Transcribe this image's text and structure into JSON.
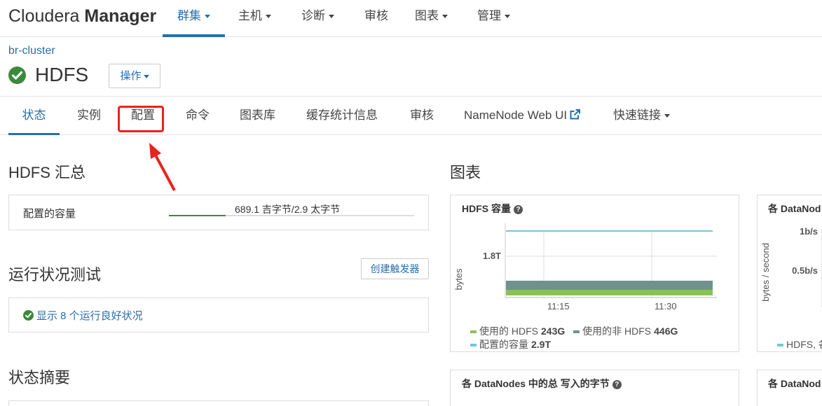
{
  "brand": {
    "part1": "Cloudera",
    "part2": "Manager"
  },
  "topnav": [
    {
      "label": "群集",
      "active": true
    },
    {
      "label": "主机"
    },
    {
      "label": "诊断"
    },
    {
      "label": "审核"
    },
    {
      "label": "图表"
    },
    {
      "label": "管理"
    }
  ],
  "breadcrumb": "br-cluster",
  "service": {
    "name": "HDFS",
    "status": "good-health",
    "actions_label": "操作"
  },
  "tabs": [
    {
      "label": "状态",
      "active": true
    },
    {
      "label": "实例"
    },
    {
      "label": "配置",
      "highlighted": true
    },
    {
      "label": "命令"
    },
    {
      "label": "图表库"
    },
    {
      "label": "缓存统计信息"
    },
    {
      "label": "审核"
    },
    {
      "label": "NameNode Web UI"
    },
    {
      "label": "快速链接"
    }
  ],
  "summary": {
    "title": "HDFS 汇总",
    "capacity_label": "配置的容量",
    "capacity_value": "689.1 吉字节/2.9 太字节",
    "capacity_fraction": 0.23
  },
  "health": {
    "title": "运行状况测试",
    "create_trigger": "创建触发器",
    "good_health_link": "显示 8 个运行良好状况"
  },
  "status_summary": {
    "title": "状态摘要"
  },
  "charts_section": {
    "title": "图表"
  },
  "charts": {
    "capacity": {
      "title": "HDFS 容量",
      "ylabel": "bytes",
      "ytick": "1.8T",
      "xticks": [
        "11:15",
        "11:30"
      ],
      "legend": [
        {
          "label": "使用的 HDFS",
          "value": "243G",
          "color": "#8ac05a"
        },
        {
          "label": "使用的非 HDFS",
          "value": "446G",
          "color": "#6f928d"
        },
        {
          "label": "配置的容量",
          "value": "2.9T",
          "color": "#72c6de"
        }
      ]
    },
    "datanode_read": {
      "title": "各 DataNod",
      "ylabel": "bytes / second",
      "yticks": [
        "1b/s",
        "0.5b/s"
      ],
      "legend_label": "HDFS, 各",
      "legend_color": "#72c6de"
    },
    "datanode_written": {
      "title": "各 DataNodes 中的总 写入的字节"
    },
    "datanode_other": {
      "title": "各 DataNod"
    }
  },
  "colors": {
    "accent": "#2a6ea8",
    "success": "#3a8a3a",
    "highlight": "#e8231c"
  }
}
